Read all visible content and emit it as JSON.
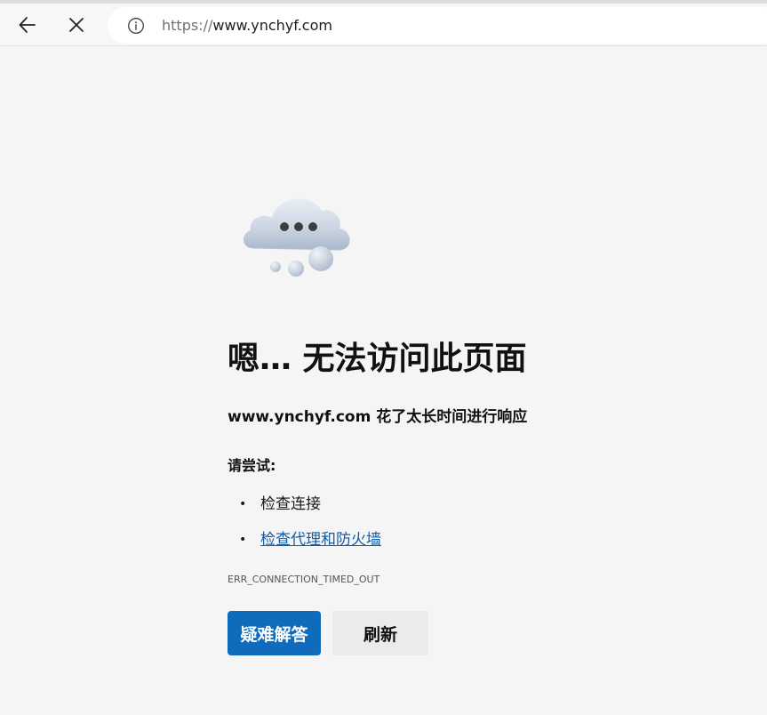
{
  "browser": {
    "url_scheme": "https://",
    "url_host": "www.ynchyf.com",
    "icons": {
      "back": "arrow-left-icon",
      "stop": "close-icon",
      "site_info": "info-icon"
    }
  },
  "error_page": {
    "title": "嗯… 无法访问此页面",
    "subtitle": "www.ynchyf.com 花了太长时间进行响应",
    "try_label": "请尝试:",
    "suggestions": [
      {
        "label": "检查连接",
        "is_link": false
      },
      {
        "label": "检查代理和防火墙",
        "is_link": true
      }
    ],
    "error_code": "ERR_CONNECTION_TIMED_OUT",
    "buttons": {
      "troubleshoot": "疑难解答",
      "refresh": "刷新"
    },
    "illustration": "cloud-thinking-illustration"
  },
  "colors": {
    "page_background": "#f5f5f5",
    "primary_button": "#0f6cbd",
    "link": "#0f5eab",
    "secondary_button": "#ebebeb"
  }
}
